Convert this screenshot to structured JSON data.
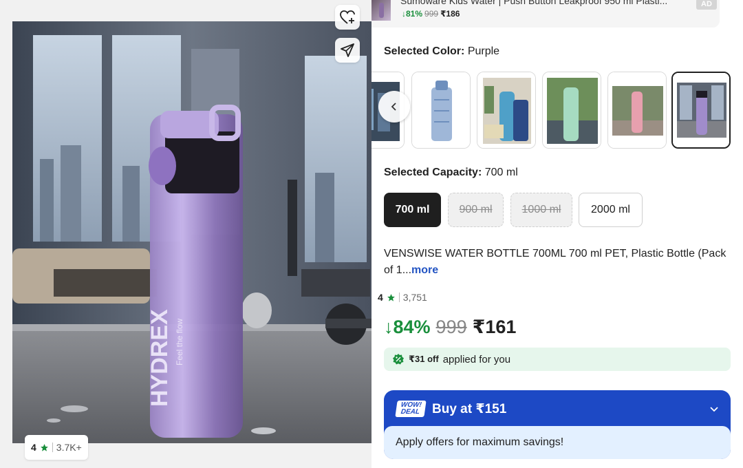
{
  "gallery": {
    "wishlist_icon": "heart-plus-icon",
    "share_icon": "paper-plane-icon",
    "rating": {
      "value": "4",
      "count": "3.7K+"
    },
    "bottle_brand_text": "HYDREX",
    "bottle_slogan_text": "Feel the flow"
  },
  "ad": {
    "title": "Sumoware Kids Water | Push Button Leakproof 950 ml Plasti...",
    "discount": "↓81%",
    "mrp": "999",
    "price": "₹186",
    "badge": "AD"
  },
  "color": {
    "label": "Selected Color:",
    "value": "Purple",
    "options": [
      "dark",
      "blue",
      "teal",
      "green",
      "pink",
      "purple"
    ],
    "selected_index": 5
  },
  "capacity": {
    "label": "Selected Capacity:",
    "value": "700 ml",
    "options": [
      {
        "label": "700 ml",
        "state": "active"
      },
      {
        "label": "900 ml",
        "state": "disabled"
      },
      {
        "label": "1000 ml",
        "state": "disabled"
      },
      {
        "label": "2000 ml",
        "state": "normal"
      }
    ]
  },
  "product": {
    "title": "VENSWISE WATER BOTTLE 700ML 700 ml PET, Plastic Bottle (Pack of 1...",
    "more": "more",
    "rating": "4",
    "rating_count": "3,751",
    "discount": "↓84%",
    "mrp": "999",
    "price": "₹161"
  },
  "coupon": {
    "amount": "₹31 off",
    "text": "applied for you"
  },
  "deal": {
    "badge_line1": "WOW!",
    "badge_line2": "DEAL",
    "label": "Buy at ₹151",
    "offers_text": "Apply offers for maximum savings!"
  },
  "colors": {
    "green": "#1a8f3c",
    "deal_blue": "#1d49c5",
    "link_blue": "#2455c3",
    "star": "#1a8f3c"
  }
}
